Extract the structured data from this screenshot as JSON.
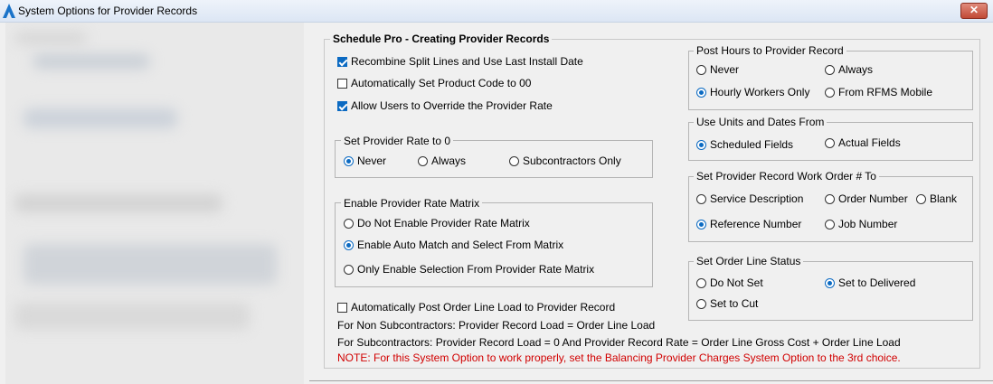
{
  "window": {
    "title": "System Options for Provider Records",
    "close_symbol": "✕"
  },
  "main_group": {
    "title": "Schedule Pro - Creating Provider Records",
    "recombine_split": {
      "label": "Recombine Split Lines and Use Last Install Date",
      "checked": true
    },
    "auto_product_code": {
      "label": "Automatically Set Product Code to 00",
      "checked": false
    },
    "allow_override": {
      "label": "Allow Users to Override the Provider Rate",
      "checked": true
    },
    "auto_post_load": {
      "label": "Automatically Post Order Line Load to Provider Record",
      "checked": false
    },
    "non_sub_text": "For Non Subcontractors:  Provider Record Load = Order Line Load",
    "sub_text": "For Subcontractors:  Provider Record Load = 0  And  Provider Record Rate = Order Line Gross Cost + Order Line Load",
    "note_text": "NOTE:  For this System Option to work properly, set the Balancing Provider Charges System Option to the 3rd choice."
  },
  "set_provider_rate": {
    "title": "Set Provider Rate to 0",
    "options": [
      "Never",
      "Always",
      "Subcontractors Only"
    ],
    "selected": "Never"
  },
  "rate_matrix": {
    "title": "Enable Provider Rate Matrix",
    "options": [
      "Do Not Enable Provider Rate Matrix",
      "Enable Auto Match and Select From Matrix",
      "Only Enable Selection From Provider Rate Matrix"
    ],
    "selected": "Enable Auto Match and Select From Matrix"
  },
  "post_hours": {
    "title": "Post Hours to Provider Record",
    "options": [
      "Never",
      "Always",
      "Hourly Workers Only",
      "From RFMS Mobile"
    ],
    "selected": "Hourly Workers Only"
  },
  "units_dates": {
    "title": "Use Units and Dates From",
    "options": [
      "Scheduled Fields",
      "Actual Fields"
    ],
    "selected": "Scheduled Fields"
  },
  "work_order": {
    "title": "Set Provider Record Work Order # To",
    "options": [
      "Service Description",
      "Order Number",
      "Blank",
      "Reference Number",
      "Job Number"
    ],
    "selected": "Reference Number"
  },
  "order_line_status": {
    "title": "Set Order Line Status",
    "options": [
      "Do Not Set",
      "Set to Delivered",
      "Set to Cut"
    ],
    "selected": "Set to Delivered"
  },
  "colors": {
    "accent": "#0b6ac2",
    "note": "#d10000",
    "background": "#f0f0f0"
  }
}
